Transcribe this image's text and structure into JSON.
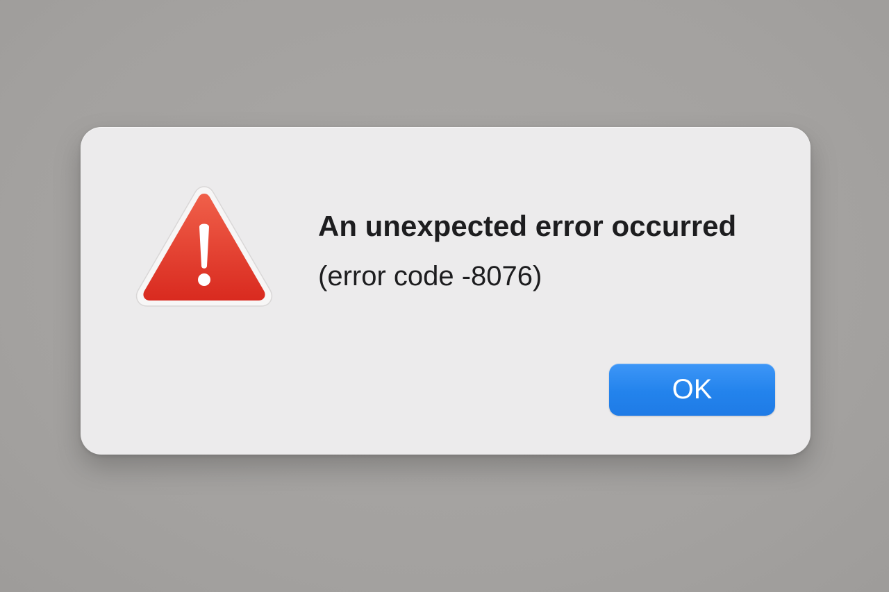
{
  "dialog": {
    "icon": "warning-triangle-icon",
    "icon_color": "#e53b2c",
    "title": "An unexpected error occurred",
    "detail": "(error code -8076)",
    "ok_button_label": "OK",
    "ok_button_color": "#2383ec"
  }
}
